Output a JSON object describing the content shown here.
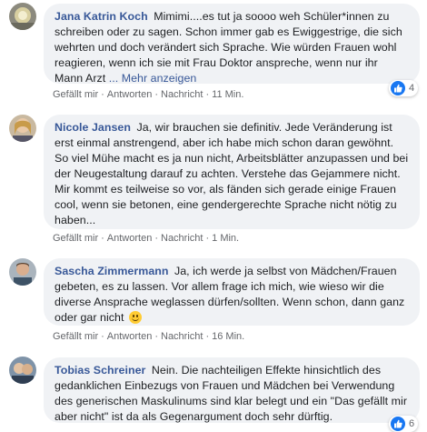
{
  "comments": [
    {
      "author": "Jana Katrin Koch",
      "text": "Mimimi....es tut ja soooo weh Schüler*innen zu schreiben oder zu sagen. Schon immer gab es Ewiggestrige, die sich wehrten und doch verändert sich Sprache. Wie würden Frauen wohl reagieren, wenn ich sie mit Frau Doktor anspreche, wenn nur ihr Mann Arzt",
      "more_label": "... Mehr anzeigen",
      "like_label": "Gefällt mir",
      "reply_label": "Antworten",
      "message_label": "Nachricht",
      "time": "11 Min.",
      "reaction_count": "4"
    },
    {
      "author": "Nicole Jansen",
      "text": "Ja, wir brauchen sie definitiv. Jede Veränderung ist erst einmal anstrengend, aber ich habe mich schon daran gewöhnt. So viel Mühe macht es ja nun nicht, Arbeitsblätter anzupassen und bei der Neugestaltung darauf zu achten. Verstehe das Gejammere nicht. Mir kommt es teilweise so vor, als fänden sich gerade einige Frauen cool, wenn sie betonen, eine gendergerechte Sprache nicht nötig zu haben...",
      "like_label": "Gefällt mir",
      "reply_label": "Antworten",
      "message_label": "Nachricht",
      "time": "1 Min."
    },
    {
      "author": "Sascha Zimmermann",
      "text": "Ja, ich werde ja selbst von Mädchen/Frauen gebeten, es zu lassen. Vor allem frage ich mich, wie wieso wir die diverse Ansprache weglassen dürfen/sollten. Wenn schon, dann ganz oder gar nicht",
      "emoji": "smiley-emoji",
      "like_label": "Gefällt mir",
      "reply_label": "Antworten",
      "message_label": "Nachricht",
      "time": "16 Min."
    },
    {
      "author": "Tobias Schreiner",
      "text": "Nein. Die nachteiligen Effekte hinsichtlich des gedanklichen Einbezugs von Frauen und Mädchen bei Verwendung des generischen Maskulinums sind klar belegt und ein \"Das gefällt mir aber nicht\" ist da als Gegenargument doch sehr dürftig.",
      "reaction_count": "6"
    }
  ],
  "colors": {
    "name": "#385898",
    "bubble": "#f0f2f5",
    "like": "#1877f2",
    "meta": "#65676b"
  },
  "icons": {
    "like": "thumbs-up-icon",
    "separator": "·"
  }
}
